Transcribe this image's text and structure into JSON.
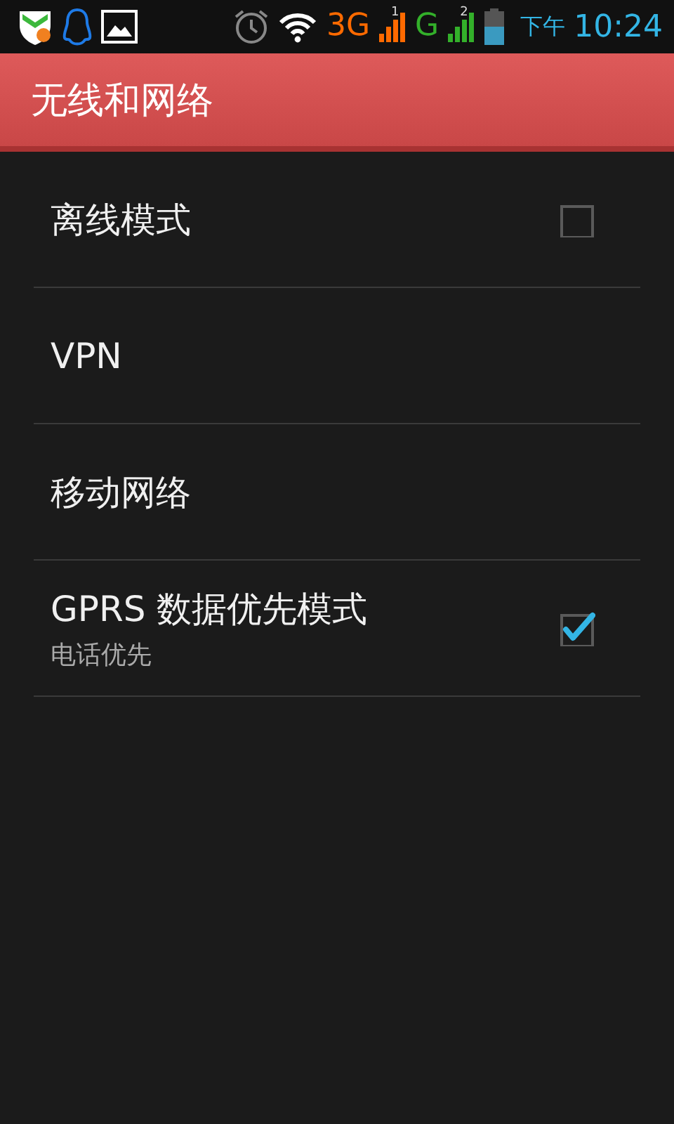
{
  "status_bar": {
    "network_1": "3G",
    "sim_1": "1",
    "network_2": "G",
    "sim_2": "2",
    "period": "下午",
    "time": "10:24"
  },
  "title_bar": {
    "title": "无线和网络"
  },
  "items": [
    {
      "kind": "checkbox",
      "title": "离线模式",
      "checked": false
    },
    {
      "kind": "plain",
      "title": "VPN"
    },
    {
      "kind": "plain",
      "title": "移动网络"
    },
    {
      "kind": "checkbox",
      "title": "GPRS 数据优先模式",
      "summary": "电话优先",
      "checked": true
    }
  ]
}
